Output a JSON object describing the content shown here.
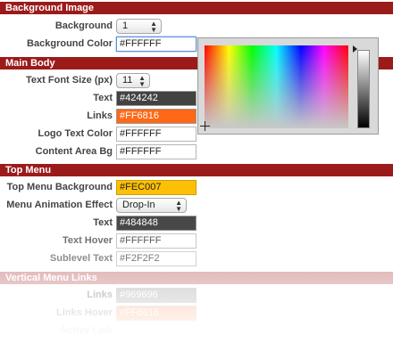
{
  "sections": {
    "background_image": "Background Image",
    "main_body": "Main Body",
    "top_menu": "Top Menu",
    "vertical_menu_links": "Vertical Menu Links"
  },
  "background_image": {
    "background": {
      "label": "Background",
      "value": "1"
    },
    "background_color": {
      "label": "Background Color",
      "value": "#FFFFFF"
    }
  },
  "main_body": {
    "text_font_size": {
      "label": "Text Font Size (px)",
      "value": "11"
    },
    "text": {
      "label": "Text",
      "value": "#424242",
      "color": "#424242"
    },
    "links": {
      "label": "Links",
      "value": "#FF6816",
      "color": "#FF6816"
    },
    "logo_text_color": {
      "label": "Logo Text Color",
      "value": "#FFFFFF"
    },
    "content_area_bg": {
      "label": "Content Area Bg",
      "value": "#FFFFFF"
    }
  },
  "top_menu": {
    "top_menu_background": {
      "label": "Top Menu Background",
      "value": "#FEC007",
      "color": "#FEC007"
    },
    "menu_animation_effect": {
      "label": "Menu Animation Effect",
      "value": "Drop-In"
    },
    "text": {
      "label": "Text",
      "value": "#484848",
      "color": "#484848"
    },
    "text_hover": {
      "label": "Text Hover",
      "value": "#FFFFFF"
    },
    "sublevel_text": {
      "label": "Sublevel Text",
      "value": "#F2F2F2"
    }
  },
  "vertical_menu_links": {
    "links": {
      "label": "Links",
      "value": "#969696",
      "color": "#969696"
    },
    "links_hover": {
      "label": "Links Hover",
      "value": "#FF6816",
      "color": "#FF6816"
    },
    "active_link": {
      "label": "Active Link"
    }
  },
  "colors": {
    "section_header": "#9B1B1B"
  }
}
